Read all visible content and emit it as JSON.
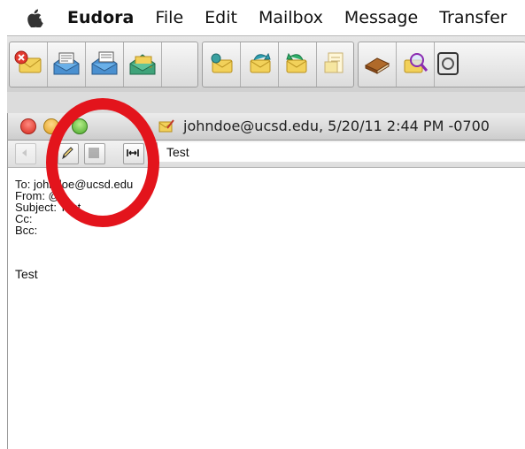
{
  "menubar": {
    "apple_icon": "apple-logo-icon",
    "app_name": "Eudora",
    "items": [
      "File",
      "Edit",
      "Mailbox",
      "Message",
      "Transfer"
    ]
  },
  "toolbar": {
    "buttons": [
      "delete-message-icon",
      "check-mail-icon",
      "send-queued-icon",
      "new-message-icon",
      "reply-icon",
      "reply-all-icon",
      "forward-icon",
      "redirect-icon",
      "address-book-icon",
      "find-icon",
      "status-icon"
    ]
  },
  "window": {
    "title": "johndoe@ucsd.edu, 5/20/11 2:44 PM -0700",
    "compose_toolbar": {
      "prev_icon": "previous-icon",
      "signature_icon": "pencil-icon",
      "encoding_icon": "encoding-icon",
      "width_icon": "wrap-width-icon",
      "subject": "Test"
    },
    "header": {
      "to": "To: johndoe@ucsd.edu",
      "from": "From: @",
      "subject": "Subject: Test",
      "cc": "Cc:",
      "bcc": "Bcc:"
    },
    "body": "Test"
  },
  "annotation": {
    "color": "#e3141c",
    "shape": "circle"
  },
  "colors": {
    "toolbar": "#d8d8d8",
    "close": "#d6281c",
    "minimize": "#e0a020",
    "zoom": "#4aa82a"
  }
}
